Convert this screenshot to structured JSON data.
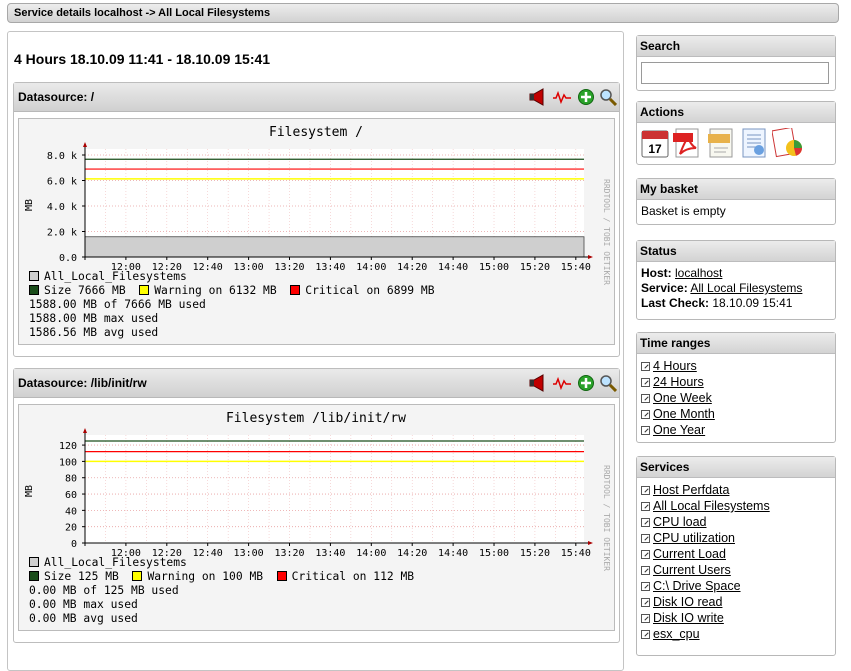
{
  "header": {
    "title": "Service details localhost -> All Local Filesystems"
  },
  "main": {
    "range_title": "4 Hours 18.10.09 11:41 - 18.10.09 15:41",
    "datasources": [
      {
        "label": "Datasource: /",
        "graph": {
          "title": "Filesystem /",
          "ylabel": "MB",
          "yticks": [
            "8.0 k",
            "6.0 k",
            "4.0 k",
            "2.0 k",
            "0.0"
          ],
          "xticks": [
            "12:00",
            "12:20",
            "12:40",
            "13:00",
            "13:20",
            "13:40",
            "14:00",
            "14:20",
            "14:40",
            "15:00",
            "15:20",
            "15:40"
          ],
          "watermark": "RRDTOOL / TOBI OETIKER"
        },
        "legend": {
          "series": "All_Local_Filesystems",
          "size": "Size 7666 MB",
          "warning": "Warning on 6132 MB",
          "critical": "Critical on 6899 MB",
          "line1": "1588.00 MB of 7666 MB used",
          "line2": "1588.00 MB max used",
          "line3": "1586.56 MB avg used"
        }
      },
      {
        "label": "Datasource: /lib/init/rw",
        "graph": {
          "title": "Filesystem /lib/init/rw",
          "ylabel": "MB",
          "yticks": [
            "120",
            "100",
            "80",
            "60",
            "40",
            "20",
            "0"
          ],
          "xticks": [
            "12:00",
            "12:20",
            "12:40",
            "13:00",
            "13:20",
            "13:40",
            "14:00",
            "14:20",
            "14:40",
            "15:00",
            "15:20",
            "15:40"
          ],
          "watermark": "RRDTOOL / TOBI OETIKER"
        },
        "legend": {
          "series": "All_Local_Filesystems",
          "size": "Size 125 MB",
          "warning": "Warning on 100 MB",
          "critical": "Critical on 112 MB",
          "line1": "0.00 MB of 125 MB used",
          "line2": "0.00 MB max used",
          "line3": "0.00 MB avg used"
        }
      }
    ]
  },
  "chart_data": [
    {
      "type": "area",
      "title": "Filesystem /",
      "ylabel": "MB",
      "ylim": [
        0,
        8000
      ],
      "x": [
        "12:00",
        "12:20",
        "12:40",
        "13:00",
        "13:20",
        "13:40",
        "14:00",
        "14:20",
        "14:40",
        "15:00",
        "15:20",
        "15:40"
      ],
      "series": [
        {
          "name": "All_Local_Filesystems",
          "values": [
            1588,
            1588,
            1588,
            1588,
            1588,
            1588,
            1588,
            1588,
            1588,
            1588,
            1588,
            1588
          ]
        }
      ],
      "size": 7666,
      "warning": 6132,
      "critical": 6899,
      "grid": true
    },
    {
      "type": "area",
      "title": "Filesystem /lib/init/rw",
      "ylabel": "MB",
      "ylim": [
        0,
        125
      ],
      "x": [
        "12:00",
        "12:20",
        "12:40",
        "13:00",
        "13:20",
        "13:40",
        "14:00",
        "14:20",
        "14:40",
        "15:00",
        "15:20",
        "15:40"
      ],
      "series": [
        {
          "name": "All_Local_Filesystems",
          "values": [
            0,
            0,
            0,
            0,
            0,
            0,
            0,
            0,
            0,
            0,
            0,
            0
          ]
        }
      ],
      "size": 125,
      "warning": 100,
      "critical": 112,
      "grid": true
    }
  ],
  "colors": {
    "size": "#1a4d1a",
    "warning": "#ffff00",
    "critical": "#ff0000",
    "area": "#cfcfcf"
  },
  "sidebar": {
    "search": {
      "title": "Search",
      "value": ""
    },
    "actions": {
      "title": "Actions",
      "icons": [
        "calendar-icon",
        "pdf-icon",
        "xml-icon",
        "report-icon",
        "chart-icon"
      ],
      "calendar_day": "17"
    },
    "basket": {
      "title": "My basket",
      "text": "Basket is empty"
    },
    "status": {
      "title": "Status",
      "host_label": "Host:",
      "host": "localhost",
      "service_label": "Service:",
      "service": "All Local Filesystems",
      "check_label": "Last Check:",
      "check": "18.10.09 15:41"
    },
    "time_ranges": {
      "title": "Time ranges",
      "items": [
        "4 Hours",
        "24 Hours",
        "One Week",
        "One Month",
        "One Year"
      ]
    },
    "services": {
      "title": "Services",
      "items": [
        "Host Perfdata",
        "All Local Filesystems",
        "CPU load",
        "CPU utilization",
        "Current Load",
        "Current Users",
        "C:\\ Drive Space",
        "Disk IO read",
        "Disk IO write",
        "esx_cpu"
      ]
    }
  }
}
